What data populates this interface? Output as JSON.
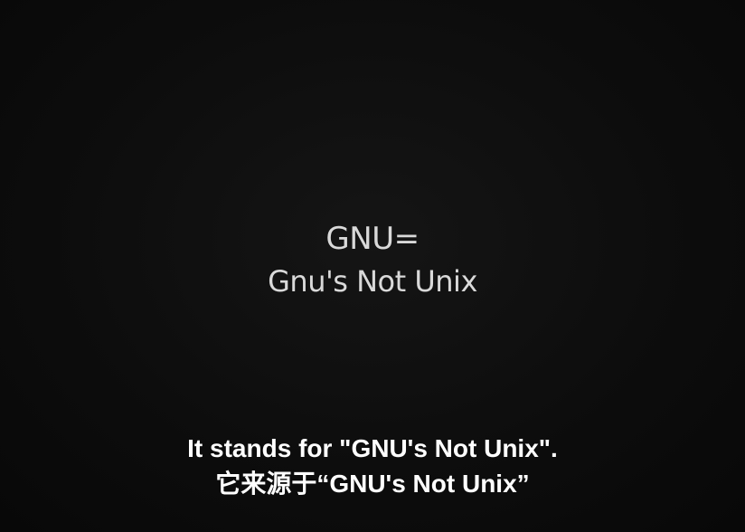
{
  "title_card": {
    "line1": "GNU=",
    "line2": "Gnu's Not Unix"
  },
  "subtitles": {
    "english": "It stands for \"GNU's Not Unix\".",
    "chinese": "它来源于“GNU's Not Unix”"
  },
  "colors": {
    "background": "#0b0b0b",
    "title_text": "#d9d9d9",
    "subtitle_text": "#ffffff"
  }
}
